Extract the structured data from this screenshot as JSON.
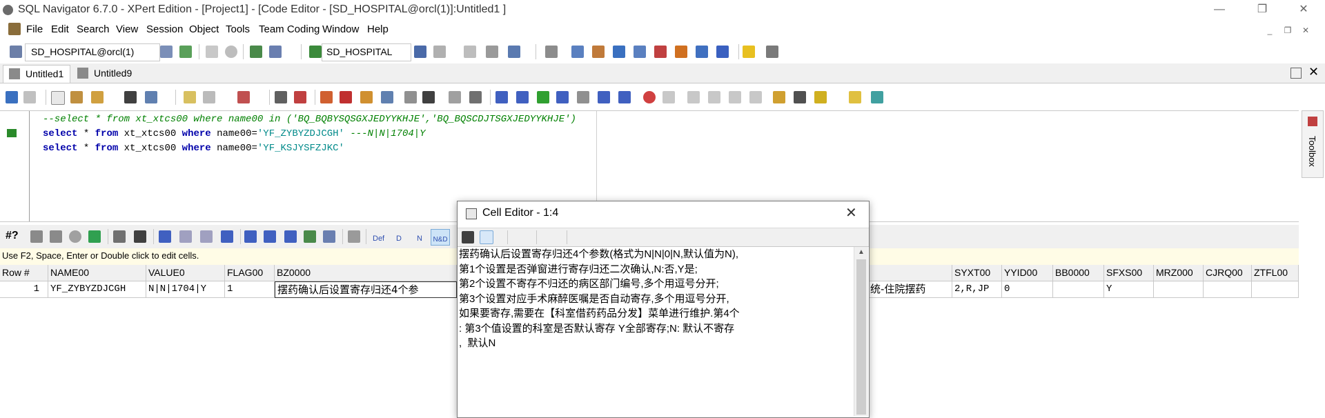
{
  "window": {
    "title": "SQL Navigator 6.7.0 - XPert Edition - [Project1] - [Code Editor - [SD_HOSPITAL@orcl(1)]:Untitled1 ]"
  },
  "menu": [
    "File",
    "Edit",
    "Search",
    "View",
    "Session",
    "Object",
    "Tools",
    "Team Coding",
    "Window",
    "Help"
  ],
  "toolbar": {
    "connection": "SD_HOSPITAL@orcl(1)",
    "schema": "SD_HOSPITAL"
  },
  "tabs": [
    {
      "label": "Untitled1",
      "active": true
    },
    {
      "label": "Untitled9",
      "active": false
    }
  ],
  "editor": {
    "lines": [
      {
        "type": "comment",
        "text": "--select * from xt_xtcs00 where name00 in ('BQ_BQBYSQSGXJEDYYKHJE','BQ_BQSCDJTSGXJEDYYKHJE')"
      },
      {
        "type": "sql",
        "kw1": "select",
        "star": " * ",
        "kw2": "from",
        "tbl": " xt_xtcs00 ",
        "kw3": "where",
        "col": " name00=",
        "val": "'YF_ZYBYZDJCGH'",
        "tail": " ---N|N|1704|Y"
      },
      {
        "type": "sql",
        "kw1": "select",
        "star": " * ",
        "kw2": "from",
        "tbl": " xt_xtcs00 ",
        "kw3": "where",
        "col": " name00=",
        "val": "'YF_KSJYSFZJKC'",
        "tail": ""
      }
    ]
  },
  "toolbox": {
    "label": "Toolbox"
  },
  "grid_toolbar": {
    "def_label": "Def",
    "d_label": "D",
    "n_label": "N",
    "nd_label": "N&D"
  },
  "grid": {
    "hint": "Use F2, Space, Enter or Double click to edit cells.",
    "columns": [
      "Row #",
      "NAME00",
      "VALUE0",
      "FLAG00",
      "BZ0000",
      "",
      "SYXT00",
      "YYID00",
      "BB0000",
      "SFXS00",
      "MRZ000",
      "CJRQ00",
      "ZTFL00"
    ],
    "rows": [
      [
        "1",
        "YF_ZYBYZDJCGH",
        "N|N|1704|Y",
        "1",
        "摆药确认后设置寄存归还4个参",
        "统-住院摆药",
        "2,R,JP",
        "0",
        "",
        "Y",
        "",
        "",
        ""
      ]
    ]
  },
  "cell_editor": {
    "title": "Cell Editor - 1:4",
    "text": "摆药确认后设置寄存归还4个参数(格式为N|N|0|N,默认值为N),\n第1个设置是否弹窗进行寄存归还二次确认,N:否,Y是;\n第2个设置不寄存不归还的病区部门编号,多个用逗号分开;\n第3个设置对应手术麻醉医嘱是否自动寄存,多个用逗号分开,\n如果要寄存,需要在【科室借药药品分发】菜单进行维护.第4个\n: 第3个值设置的科室是否默认寄存 Y全部寄存;N: 默认不寄存\n,  默认N"
  }
}
